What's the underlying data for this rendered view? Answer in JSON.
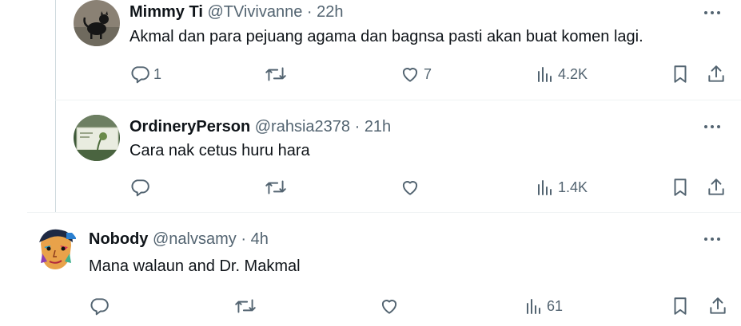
{
  "tweets": [
    {
      "name": "Mimmy Ti",
      "handle": "@TVivivanne",
      "separator": "·",
      "time": "22h",
      "text": "Akmal dan para pejuang agama dan bagnsa pasti akan buat komen lagi.",
      "replies": "1",
      "retweets": "",
      "likes": "7",
      "views": "4.2K",
      "avatar_icon": "black-cat-avatar"
    },
    {
      "name": "OrdineryPerson",
      "handle": "@rahsia2378",
      "separator": "·",
      "time": "21h",
      "text": "Cara nak cetus huru hara",
      "replies": "",
      "retweets": "",
      "likes": "",
      "views": "1.4K",
      "avatar_icon": "landscape-photo-avatar"
    },
    {
      "name": "Nobody",
      "handle": "@nalvsamy",
      "separator": "·",
      "time": "4h",
      "text": "Mana walaun and Dr. Makmal",
      "replies": "",
      "retweets": "",
      "likes": "",
      "views": "61",
      "avatar_icon": "pop-art-face-avatar"
    }
  ],
  "icons": {
    "reply": "reply-icon",
    "retweet": "retweet-icon",
    "like": "heart-icon",
    "views": "views-chart-icon",
    "bookmark": "bookmark-icon",
    "share": "share-icon",
    "more": "more-icon"
  },
  "colors": {
    "text_primary": "#0f1419",
    "text_secondary": "#536471",
    "divider": "#eff3f4",
    "thread_line": "#cfd9de"
  }
}
